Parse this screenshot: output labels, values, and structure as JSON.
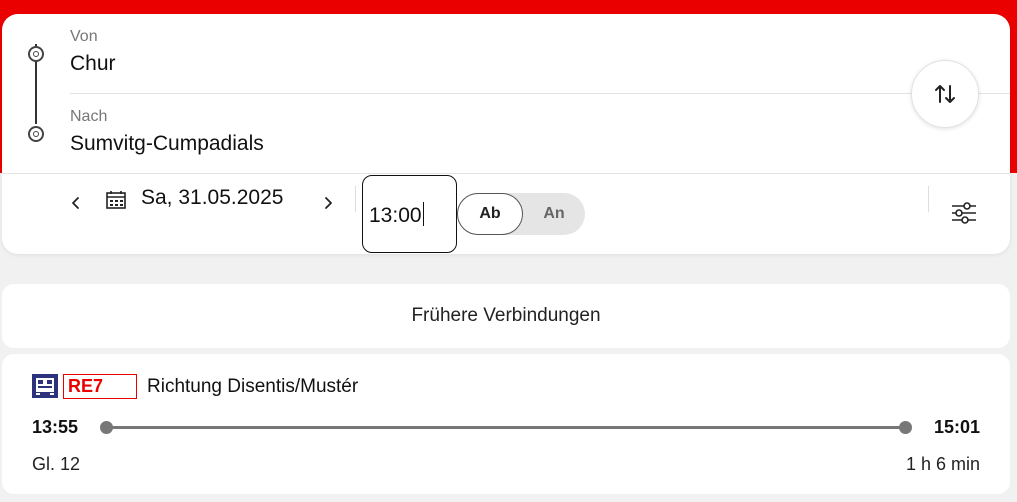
{
  "search": {
    "from_label": "Von",
    "from_value": "Chur",
    "to_label": "Nach",
    "to_value": "Sumvitg-Cumpadials",
    "date": "Sa, 31.05.2025",
    "time": "13:00",
    "toggle": {
      "ab_label": "Ab",
      "an_label": "An",
      "selected": "Ab"
    },
    "icons": {
      "swap": "swap-arrows-icon",
      "prev": "chevron-left-icon",
      "next": "chevron-right-icon",
      "calendar": "calendar-icon",
      "filter": "sliders-icon"
    }
  },
  "earlier_connections_label": "Frühere Verbindungen",
  "connections": [
    {
      "line": "RE7",
      "direction": "Richtung Disentis/Mustér",
      "departure": "13:55",
      "arrival": "15:01",
      "platform": "Gl. 12",
      "duration": "1 h 6 min",
      "icon": "train-icon"
    }
  ],
  "colors": {
    "brand_red": "#eb0000",
    "background": "#f1f1f1",
    "card": "#ffffff"
  }
}
